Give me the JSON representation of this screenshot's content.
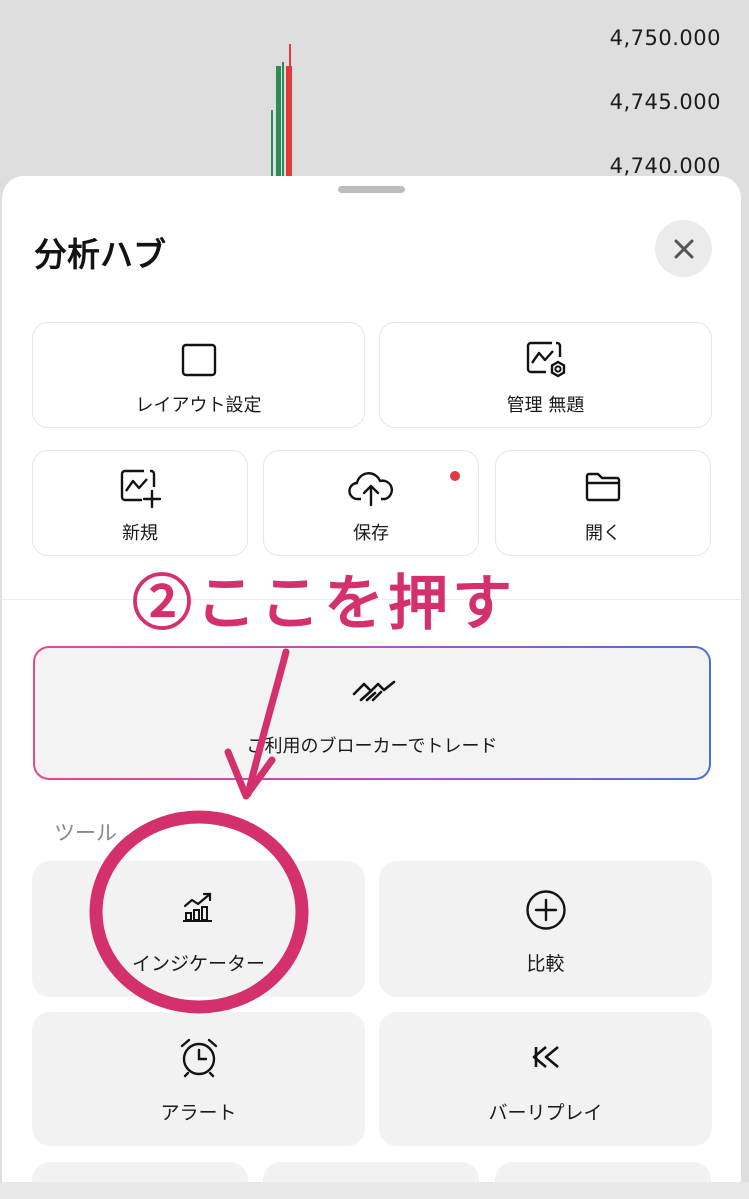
{
  "chart": {
    "prices": [
      "4,750.000",
      "4,745.000",
      "4,740.000"
    ],
    "colors": {
      "up": "#2e8b57",
      "down": "#e03a3a"
    }
  },
  "sheet": {
    "title": "分析ハブ",
    "close_icon": "close-icon",
    "layout_card": {
      "label": "レイアウト設定",
      "icon": "square-icon"
    },
    "manage_card": {
      "label": "管理 無題",
      "icon": "chart-gear-icon"
    },
    "new_card": {
      "label": "新規",
      "icon": "chart-plus-icon"
    },
    "save_card": {
      "label": "保存",
      "icon": "cloud-upload-icon"
    },
    "open_card": {
      "label": "開く",
      "icon": "folder-icon"
    },
    "broker_card": {
      "label": "ご利用のブローカーでトレード",
      "icon": "trade-handshake-icon"
    },
    "tools_label": "ツール",
    "tools": [
      {
        "label": "インジケーター",
        "icon": "indicators-icon"
      },
      {
        "label": "比較",
        "icon": "plus-circle-icon"
      },
      {
        "label": "アラート",
        "icon": "alarm-clock-icon"
      },
      {
        "label": "バーリプレイ",
        "icon": "rewind-icon"
      }
    ]
  },
  "annotation": {
    "text": "②ここを押す",
    "color": "#d4306e"
  }
}
